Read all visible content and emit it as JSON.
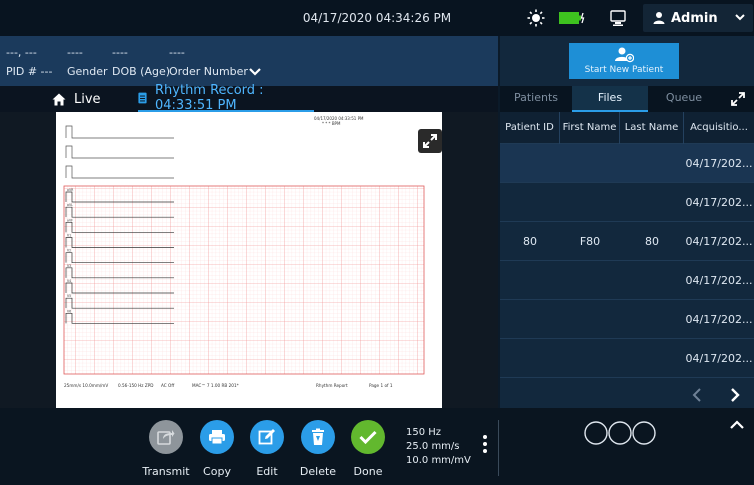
{
  "datetime": "04/17/2020 04:34:26 PM",
  "user": {
    "name": "Admin"
  },
  "icons": [
    "sun-icon",
    "battery-icon",
    "monitor-icon",
    "user-icon",
    "chevron-down-icon",
    "home-icon",
    "document-icon",
    "expand-icon",
    "add-user-icon",
    "chevron-left-icon",
    "chevron-right-icon",
    "share-icon",
    "printer-icon",
    "edit-icon",
    "trash-icon",
    "check-icon",
    "more-vertical-icon",
    "circle-icon",
    "chevron-up-icon"
  ],
  "patient_header": {
    "name_placeholder": "---, ---",
    "gender_value": "----",
    "dob_value": "----",
    "order_value": "----",
    "pid_label": "PID # ---",
    "gender_label": "Gender",
    "dob_label": "DOB (Age)",
    "order_label": "Order Number"
  },
  "tabs": {
    "live": "Live",
    "record": "Rhythm Record : 04:33:51 PM"
  },
  "record": {
    "stamp": "04/17/2020 04:33:51 PM",
    "stamp_sub": "* * * BPM",
    "footer": [
      "25mm/s  10.0mm/mV",
      "0.56-150 Hz ZPD",
      "AC Off",
      "MAC™ 7 1.00 RB 201*",
      "Rhythm Report",
      "Page 1 of 1"
    ],
    "leads": [
      "I",
      "II",
      "III",
      "aVR",
      "aVL",
      "aVF",
      "V1",
      "V2",
      "V3",
      "V4",
      "V5",
      "V6"
    ]
  },
  "right_panel": {
    "new_patient": "Start New Patient",
    "tabs": [
      "Patients",
      "Files",
      "Queue"
    ],
    "active_tab": "Files",
    "columns": [
      "Patient ID",
      "First Name",
      "Last Name",
      "Acquisitio..."
    ],
    "rows": [
      [
        "",
        "",
        "",
        "04/17/202..."
      ],
      [
        "",
        "",
        "",
        "04/17/202..."
      ],
      [
        "80",
        "F80",
        "80",
        "04/17/202..."
      ],
      [
        "",
        "",
        "",
        "04/17/202..."
      ],
      [
        "",
        "",
        "",
        "04/17/202..."
      ],
      [
        "",
        "",
        "",
        "04/17/202..."
      ]
    ]
  },
  "actions": [
    {
      "label": "Transmit",
      "enabled": false
    },
    {
      "label": "Copy",
      "enabled": true
    },
    {
      "label": "Edit",
      "enabled": true
    },
    {
      "label": "Delete",
      "enabled": true
    },
    {
      "label": "Done",
      "enabled": true
    }
  ],
  "settings": {
    "filter": "150 Hz",
    "speed": "25.0 mm/s",
    "gain": "10.0 mm/mV"
  },
  "colors": {
    "accent": "#1e8fd6",
    "done": "#62b82e",
    "panel": "#12283d",
    "grid": "#f4a4a4"
  }
}
